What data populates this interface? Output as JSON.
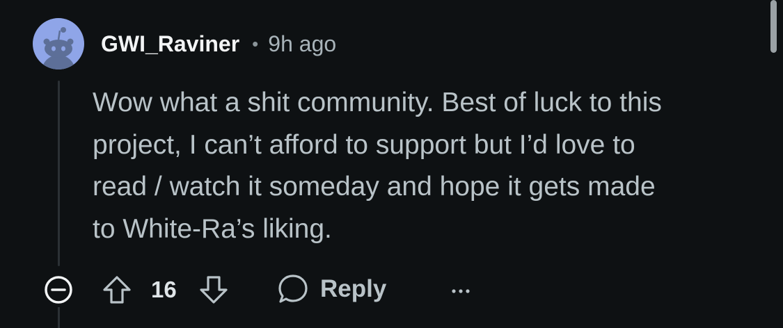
{
  "comment": {
    "username": "GWI_Raviner",
    "separator": "•",
    "time_ago": "9h ago",
    "body_lines": [
      "Wow what a shit community. Best of luck to this",
      "project, I can’t afford to support but I’d love to",
      "read / watch it someday and hope it gets made",
      "to White-Ra’s liking."
    ]
  },
  "actions": {
    "vote_count": "16",
    "reply_label": "Reply"
  },
  "icons": {
    "avatar": "snoo-avatar-icon",
    "collapse": "collapse-minus-icon",
    "upvote": "arrow-up-icon",
    "downvote": "arrow-down-icon",
    "reply": "speech-bubble-icon",
    "more": "ellipsis-icon"
  },
  "colors": {
    "background": "#0e1113",
    "avatar_background": "#8fa5e8",
    "username": "#f2f4f5",
    "body_text": "#b9c3c8"
  }
}
